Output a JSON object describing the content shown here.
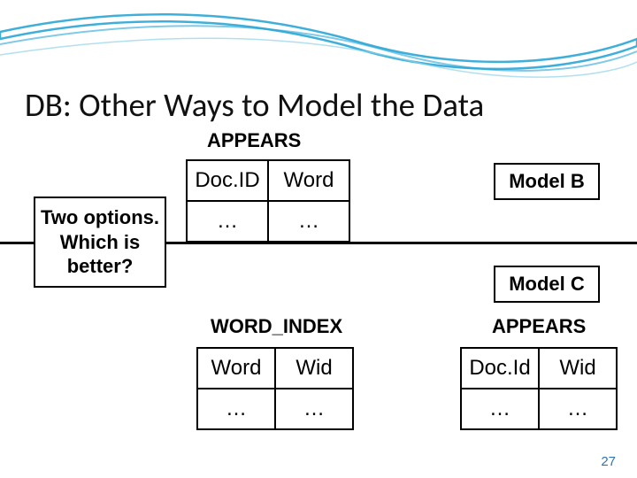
{
  "title": "DB: Other Ways to Model the Data",
  "labels": {
    "appears_top": "APPEARS",
    "word_index": "WORD_INDEX",
    "appears_right": "APPEARS",
    "two_options": "Two options. Which is better?",
    "model_b": "Model B",
    "model_c": "Model C"
  },
  "table_appears_top": {
    "col1": "Doc.ID",
    "col2": "Word",
    "r1c1": "…",
    "r1c2": "…"
  },
  "table_word_index": {
    "col1": "Word",
    "col2": "Wid",
    "r1c1": "…",
    "r1c2": "…"
  },
  "table_appears_bottom": {
    "col1": "Doc.Id",
    "col2": "Wid",
    "r1c1": "…",
    "r1c2": "…"
  },
  "slide_number": "27"
}
